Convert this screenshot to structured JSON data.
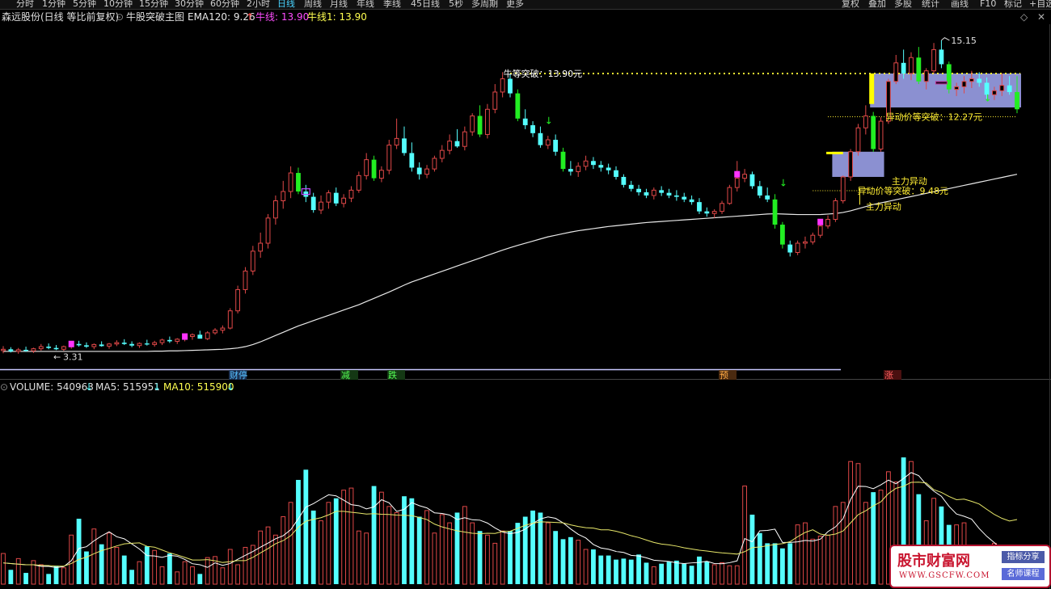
{
  "toolbar": {
    "periods": [
      "分时",
      "1分钟",
      "5分钟",
      "10分钟",
      "15分钟",
      "30分钟",
      "60分钟",
      "2小时",
      "日线",
      "周线",
      "月线",
      "年线",
      "季线",
      "45日线",
      "5秒",
      "多周期",
      "更多"
    ],
    "active_period": "日线",
    "right": [
      "复权",
      "叠加",
      "多股",
      "统计",
      "画线",
      "F10",
      "标记",
      "+自选"
    ]
  },
  "info": {
    "stock": "森远股份(日线 等比前复权)",
    "indicator": "牛股突破主图",
    "ema_label": "EMA120: 9.26",
    "niu_label": "牛线: 13.90",
    "niu1_label": "牛线1: 13.90"
  },
  "volume_info": {
    "volume_label": "VOLUME: 540963",
    "ma5_label": "MA5: 515951",
    "ma10_label": "MA10: 515900"
  },
  "annotations": {
    "niu_breakout": "牛等突破：13.90元",
    "yidong_breakout1": "异动价等突破：12.27元",
    "yidong_breakout2": "异动价等突破：9.48元",
    "zhuli1": "主力异动",
    "zhuli2": "主力异动",
    "high_price": "15.15",
    "low_price": "3.31"
  },
  "event_markers": [
    "财停",
    "减",
    "跌",
    "预",
    "涨"
  ],
  "colors": {
    "up": "#e04848",
    "down": "#55ffff",
    "signal": "#22ee22",
    "ema": "#e8e8e8",
    "ma5": "#ffffff",
    "ma10": "#e8e86a",
    "box": "#9aa0e8"
  },
  "logo": {
    "main": "股市财富网",
    "url": "WWW.GSCFW.COM",
    "tag1": "指标分享",
    "tag2": "名师课程"
  },
  "chart_data": {
    "type": "candlestick",
    "title": "森远股份(日线 等比前复权)",
    "price_range": [
      2.9,
      15.3
    ],
    "high": 15.15,
    "low": 3.31,
    "ohlc": [
      [
        3.45,
        3.62,
        3.35,
        3.5
      ],
      [
        3.5,
        3.58,
        3.38,
        3.42
      ],
      [
        3.42,
        3.55,
        3.33,
        3.48
      ],
      [
        3.48,
        3.6,
        3.4,
        3.44
      ],
      [
        3.44,
        3.56,
        3.36,
        3.52
      ],
      [
        3.52,
        3.7,
        3.45,
        3.6
      ],
      [
        3.6,
        3.72,
        3.5,
        3.55
      ],
      [
        3.55,
        3.66,
        3.47,
        3.5
      ],
      [
        3.5,
        3.64,
        3.44,
        3.6
      ],
      [
        3.6,
        3.78,
        3.52,
        3.7
      ],
      [
        3.7,
        3.82,
        3.6,
        3.65
      ],
      [
        3.65,
        3.76,
        3.55,
        3.6
      ],
      [
        3.6,
        3.72,
        3.5,
        3.68
      ],
      [
        3.68,
        3.8,
        3.6,
        3.62
      ],
      [
        3.62,
        3.74,
        3.52,
        3.7
      ],
      [
        3.7,
        3.84,
        3.62,
        3.75
      ],
      [
        3.75,
        3.88,
        3.66,
        3.7
      ],
      [
        3.7,
        3.8,
        3.58,
        3.64
      ],
      [
        3.64,
        3.76,
        3.55,
        3.72
      ],
      [
        3.72,
        3.86,
        3.64,
        3.68
      ],
      [
        3.68,
        3.82,
        3.6,
        3.75
      ],
      [
        3.75,
        3.9,
        3.66,
        3.85
      ],
      [
        3.85,
        3.98,
        3.74,
        3.8
      ],
      [
        3.8,
        3.92,
        3.7,
        3.88
      ],
      [
        3.88,
        4.05,
        3.8,
        3.98
      ],
      [
        3.98,
        4.1,
        3.86,
        4.05
      ],
      [
        4.05,
        4.2,
        3.92,
        3.9
      ],
      [
        3.9,
        4.18,
        3.85,
        4.12
      ],
      [
        4.12,
        4.3,
        4.05,
        4.22
      ],
      [
        4.22,
        4.4,
        4.1,
        4.3
      ],
      [
        4.3,
        5.05,
        4.25,
        4.95
      ],
      [
        4.95,
        5.9,
        4.85,
        5.75
      ],
      [
        5.75,
        6.6,
        5.6,
        6.45
      ],
      [
        6.45,
        7.4,
        6.3,
        7.2
      ],
      [
        7.2,
        7.9,
        6.95,
        7.5
      ],
      [
        7.5,
        8.6,
        7.3,
        8.45
      ],
      [
        8.45,
        9.3,
        8.2,
        9.1
      ],
      [
        9.1,
        9.85,
        8.8,
        9.45
      ],
      [
        9.45,
        10.4,
        9.2,
        10.15
      ],
      [
        10.15,
        10.35,
        9.35,
        9.45
      ],
      [
        9.45,
        9.7,
        9.05,
        9.25
      ],
      [
        9.25,
        9.4,
        8.65,
        8.75
      ],
      [
        8.75,
        9.3,
        8.6,
        9.05
      ],
      [
        9.05,
        9.5,
        8.8,
        9.4
      ],
      [
        9.4,
        9.6,
        8.9,
        9.0
      ],
      [
        9.0,
        9.35,
        8.85,
        9.2
      ],
      [
        9.2,
        9.65,
        9.05,
        9.5
      ],
      [
        9.5,
        10.2,
        9.4,
        10.05
      ],
      [
        10.05,
        10.9,
        9.9,
        10.65
      ],
      [
        10.65,
        10.8,
        9.85,
        9.95
      ],
      [
        9.95,
        10.4,
        9.8,
        10.25
      ],
      [
        10.25,
        11.4,
        10.1,
        11.2
      ],
      [
        11.2,
        12.2,
        11.05,
        11.45
      ],
      [
        11.45,
        11.9,
        10.8,
        10.9
      ],
      [
        10.9,
        11.3,
        10.2,
        10.35
      ],
      [
        10.35,
        10.55,
        9.9,
        10.1
      ],
      [
        10.1,
        10.45,
        9.95,
        10.3
      ],
      [
        10.3,
        10.8,
        10.2,
        10.7
      ],
      [
        10.7,
        11.2,
        10.55,
        11.0
      ],
      [
        11.0,
        11.6,
        10.85,
        11.35
      ],
      [
        11.35,
        11.8,
        11.1,
        11.15
      ],
      [
        11.15,
        11.9,
        11.0,
        11.7
      ],
      [
        11.7,
        12.4,
        11.55,
        12.3
      ],
      [
        12.3,
        12.7,
        11.5,
        11.6
      ],
      [
        11.6,
        12.75,
        11.45,
        12.55
      ],
      [
        12.55,
        13.5,
        12.4,
        13.2
      ],
      [
        13.2,
        13.95,
        13.0,
        13.7
      ],
      [
        13.7,
        13.9,
        13.0,
        13.15
      ],
      [
        13.15,
        13.3,
        12.1,
        12.2
      ],
      [
        12.2,
        12.55,
        11.8,
        11.95
      ],
      [
        11.95,
        12.1,
        11.5,
        11.65
      ],
      [
        11.65,
        11.9,
        11.1,
        11.2
      ],
      [
        11.2,
        11.55,
        11.05,
        11.4
      ],
      [
        11.4,
        11.6,
        10.8,
        10.95
      ],
      [
        10.95,
        11.1,
        10.2,
        10.3
      ],
      [
        10.3,
        10.6,
        10.05,
        10.2
      ],
      [
        10.2,
        10.55,
        10.0,
        10.4
      ],
      [
        10.4,
        10.8,
        10.25,
        10.6
      ],
      [
        10.6,
        10.75,
        10.3,
        10.45
      ],
      [
        10.45,
        10.6,
        10.2,
        10.35
      ],
      [
        10.35,
        10.5,
        10.1,
        10.25
      ],
      [
        10.25,
        10.4,
        9.9,
        10.0
      ],
      [
        10.0,
        10.1,
        9.6,
        9.7
      ],
      [
        9.7,
        9.85,
        9.45,
        9.55
      ],
      [
        9.55,
        9.7,
        9.3,
        9.42
      ],
      [
        9.42,
        9.55,
        9.2,
        9.3
      ],
      [
        9.3,
        9.6,
        9.15,
        9.5
      ],
      [
        9.5,
        9.65,
        9.28,
        9.4
      ],
      [
        9.4,
        9.55,
        9.2,
        9.3
      ],
      [
        9.3,
        9.5,
        9.1,
        9.25
      ],
      [
        9.25,
        9.4,
        9.05,
        9.15
      ],
      [
        9.15,
        9.3,
        8.95,
        9.05
      ],
      [
        9.05,
        9.2,
        8.6,
        8.7
      ],
      [
        8.7,
        8.85,
        8.5,
        8.62
      ],
      [
        8.62,
        8.78,
        8.45,
        8.7
      ],
      [
        8.7,
        9.1,
        8.6,
        9.0
      ],
      [
        9.0,
        9.7,
        8.95,
        9.6
      ],
      [
        9.6,
        10.6,
        9.45,
        9.95
      ],
      [
        9.95,
        10.3,
        9.8,
        10.1
      ],
      [
        10.1,
        10.2,
        9.55,
        9.65
      ],
      [
        9.65,
        9.85,
        9.2,
        9.3
      ],
      [
        9.3,
        9.6,
        9.05,
        9.15
      ],
      [
        9.15,
        9.35,
        8.05,
        8.2
      ],
      [
        8.2,
        8.3,
        7.3,
        7.45
      ],
      [
        7.45,
        7.6,
        7.0,
        7.15
      ],
      [
        7.15,
        7.6,
        7.05,
        7.5
      ],
      [
        7.5,
        7.75,
        7.3,
        7.55
      ],
      [
        7.55,
        7.9,
        7.45,
        7.8
      ],
      [
        7.8,
        8.3,
        7.7,
        8.15
      ],
      [
        8.15,
        8.55,
        8.05,
        8.4
      ],
      [
        8.4,
        9.2,
        8.3,
        9.1
      ],
      [
        9.1,
        10.05,
        9.0,
        10.0
      ],
      [
        10.0,
        11.05,
        9.85,
        10.95
      ],
      [
        10.95,
        12.0,
        10.8,
        11.85
      ],
      [
        11.85,
        12.7,
        11.6,
        12.3
      ],
      [
        12.3,
        12.45,
        10.95,
        11.05
      ],
      [
        11.05,
        12.25,
        10.95,
        12.1
      ],
      [
        12.1,
        13.7,
        12.0,
        13.6
      ],
      [
        13.6,
        14.6,
        13.5,
        14.3
      ],
      [
        14.3,
        14.8,
        13.7,
        13.9
      ],
      [
        13.9,
        14.7,
        13.65,
        14.5
      ],
      [
        14.5,
        14.9,
        13.5,
        13.6
      ],
      [
        13.6,
        14.1,
        13.3,
        14.0
      ],
      [
        14.0,
        15.05,
        13.9,
        14.8
      ],
      [
        14.8,
        15.15,
        14.1,
        14.25
      ],
      [
        14.25,
        14.35,
        13.15,
        13.3
      ],
      [
        13.3,
        13.55,
        13.05,
        13.4
      ],
      [
        13.4,
        13.8,
        13.15,
        13.6
      ],
      [
        13.6,
        14.0,
        13.35,
        13.7
      ],
      [
        13.7,
        13.95,
        13.4,
        13.55
      ],
      [
        13.55,
        13.75,
        12.95,
        13.1
      ],
      [
        13.1,
        13.4,
        12.9,
        13.25
      ],
      [
        13.25,
        13.9,
        13.05,
        13.45
      ],
      [
        13.45,
        13.8,
        13.1,
        13.2
      ],
      [
        13.2,
        13.8,
        12.4,
        12.55
      ]
    ],
    "ema120": [
      3.42,
      3.42,
      3.42,
      3.42,
      3.42,
      3.42,
      3.42,
      3.42,
      3.42,
      3.42,
      3.42,
      3.42,
      3.42,
      3.42,
      3.42,
      3.42,
      3.42,
      3.42,
      3.42,
      3.42,
      3.43,
      3.43,
      3.44,
      3.44,
      3.45,
      3.46,
      3.47,
      3.48,
      3.49,
      3.5,
      3.52,
      3.55,
      3.6,
      3.68,
      3.78,
      3.9,
      4.02,
      4.14,
      4.26,
      4.38,
      4.48,
      4.58,
      4.68,
      4.78,
      4.88,
      4.98,
      5.08,
      5.18,
      5.3,
      5.42,
      5.54,
      5.66,
      5.79,
      5.92,
      6.04,
      6.14,
      6.24,
      6.34,
      6.44,
      6.54,
      6.64,
      6.74,
      6.84,
      6.94,
      7.04,
      7.14,
      7.24,
      7.33,
      7.42,
      7.5,
      7.58,
      7.66,
      7.74,
      7.8,
      7.86,
      7.92,
      7.97,
      8.01,
      8.05,
      8.09,
      8.13,
      8.16,
      8.19,
      8.22,
      8.25,
      8.28,
      8.3,
      8.32,
      8.34,
      8.36,
      8.38,
      8.4,
      8.42,
      8.44,
      8.46,
      8.48,
      8.5,
      8.52,
      8.54,
      8.56,
      8.58,
      8.6,
      8.61,
      8.6,
      8.59,
      8.58,
      8.58,
      8.58,
      8.58,
      8.6,
      8.62,
      8.66,
      8.72,
      8.8,
      8.88,
      8.96,
      9.02,
      9.08,
      9.14,
      9.2,
      9.26,
      9.32,
      9.38,
      9.44,
      9.5,
      9.56,
      9.62,
      9.68,
      9.74,
      9.8,
      9.86,
      9.92,
      9.98,
      10.04,
      10.1
    ],
    "volume_range": [
      0,
      1000000
    ],
    "volume": [
      150000,
      70000,
      125000,
      55000,
      115000,
      95000,
      50000,
      90000,
      80000,
      240000,
      320000,
      160000,
      270000,
      195000,
      250000,
      180000,
      140000,
      70000,
      110000,
      185000,
      165000,
      85000,
      150000,
      60000,
      110000,
      85000,
      50000,
      130000,
      135000,
      80000,
      170000,
      95000,
      180000,
      190000,
      260000,
      280000,
      240000,
      330000,
      400000,
      510000,
      560000,
      360000,
      310000,
      400000,
      420000,
      460000,
      470000,
      260000,
      250000,
      480000,
      450000,
      380000,
      350000,
      430000,
      420000,
      330000,
      360000,
      250000,
      340000,
      300000,
      350000,
      380000,
      300000,
      260000,
      240000,
      200000,
      260000,
      260000,
      300000,
      330000,
      360000,
      350000,
      300000,
      260000,
      220000,
      230000,
      215000,
      170000,
      170000,
      140000,
      140000,
      120000,
      125000,
      120000,
      145000,
      105000,
      85000,
      100000,
      110000,
      115000,
      100000,
      90000,
      135000,
      110000,
      95000,
      105000,
      90000,
      90000,
      480000,
      340000,
      250000,
      200000,
      200000,
      175000,
      200000,
      290000,
      300000,
      220000,
      235000,
      240000,
      380000,
      400000,
      600000,
      590000,
      400000,
      450000,
      460000,
      550000,
      500000,
      620000,
      600000,
      440000,
      310000,
      420000,
      380000,
      290000,
      290000,
      300000,
      160000,
      180000,
      120000,
      200000,
      170000,
      150000,
      180000
    ],
    "ma5": [
      104000,
      101000,
      98000,
      95000,
      95000,
      87000,
      87000,
      81000,
      86000,
      115000,
      175000,
      183000,
      212000,
      236000,
      256000,
      232000,
      222000,
      197000,
      172000,
      140000,
      138000,
      131000,
      141000,
      137000,
      121000,
      100000,
      95000,
      82000,
      104000,
      92000,
      101000,
      122000,
      141000,
      160000,
      181000,
      201000,
      222000,
      237000,
      266000,
      320000,
      377000,
      394000,
      416000,
      437000,
      432000,
      411000,
      389000,
      384000,
      368000,
      378000,
      413000,
      398000,
      356000,
      366000,
      399000,
      384000,
      373000,
      349000,
      346000,
      338000,
      316000,
      325000,
      315000,
      313000,
      299000,
      275000,
      255000,
      247000,
      253000,
      269000,
      297000,
      319000,
      329000,
      322000,
      300000,
      270000,
      244000,
      226000,
      194000,
      177000,
      171000,
      160000,
      155000,
      141000,
      138000,
      129000,
      117000,
      114000,
      111000,
      104000,
      101000,
      104000,
      106000,
      112000,
      101000,
      100000,
      105000,
      114000,
      223000,
      207000,
      261000,
      263000,
      269000,
      204000,
      204000,
      207000,
      214000,
      211000,
      220000,
      257000,
      280000,
      320000,
      414000,
      479000,
      478000,
      467000,
      486000,
      509000,
      491000,
      517000,
      546000,
      531000,
      487000,
      455000,
      430000,
      381000,
      343000,
      332000,
      318000,
      272000,
      234000,
      203000,
      169000,
      171000,
      165000
    ],
    "ma10": [
      104000,
      101000,
      98000,
      95000,
      95000,
      92000,
      91000,
      88000,
      88000,
      101000,
      121000,
      132000,
      149000,
      164000,
      175000,
      187000,
      197000,
      200000,
      202000,
      185000,
      181000,
      167000,
      153000,
      143000,
      131000,
      118000,
      118000,
      120000,
      114000,
      106000,
      110000,
      115000,
      115000,
      131000,
      153000,
      174000,
      198000,
      213000,
      237000,
      278000,
      308000,
      317000,
      325000,
      339000,
      356000,
      356000,
      352000,
      348000,
      343000,
      345000,
      342000,
      341000,
      338000,
      337000,
      335000,
      326000,
      316000,
      294000,
      280000,
      270000,
      261000,
      255000,
      249000,
      247000,
      249000,
      248000,
      258000,
      259000,
      273000,
      288000,
      298000,
      305000,
      304000,
      302000,
      300000,
      290000,
      282000,
      276000,
      274000,
      266000,
      266000,
      259000,
      249000,
      237000,
      228000,
      216000,
      204000,
      196000,
      192000,
      186000,
      178000,
      172000,
      166000,
      162000,
      157000,
      153000,
      150000,
      147000,
      159000,
      179000,
      182000,
      188000,
      194000,
      198000,
      208000,
      232000,
      253000,
      266000,
      245000,
      239000,
      245000,
      260000,
      300000,
      340000,
      359000,
      383000,
      403000,
      443000,
      469000,
      479000,
      498000,
      499000,
      495000,
      462000,
      449000,
      429000,
      413000,
      416000,
      405000,
      392000,
      366000,
      341000,
      322000,
      309000,
      316000
    ]
  }
}
